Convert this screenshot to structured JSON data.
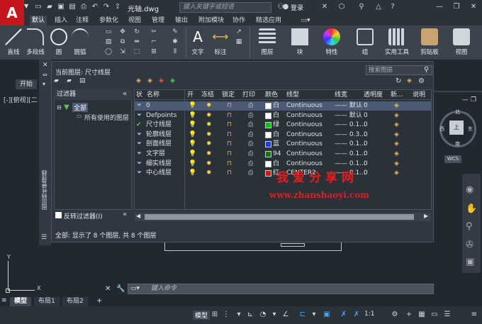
{
  "app": {
    "logo": "A",
    "filename": "光轴.dwg",
    "search_placeholder": "键入关键字或短语",
    "login": "登录"
  },
  "ribbon_tabs": [
    "默认",
    "插入",
    "注释",
    "参数化",
    "视图",
    "管理",
    "输出",
    "附加模块",
    "协作",
    "精选应用"
  ],
  "ribbon_buttons": [
    "直线",
    "多段线",
    "圆",
    "圆弧",
    "文字",
    "标注",
    "图层",
    "块",
    "特性",
    "组",
    "实用工具",
    "剪贴板",
    "视图"
  ],
  "start_tab": "开始",
  "view_label": "[-][俯视][二",
  "layer_panel": {
    "vertical_title": "图层特性管理器",
    "current_layer": "当前图层: 尺寸线层",
    "search_placeholder": "搜索图层",
    "filter_header": "过滤器",
    "filter_all": "全部",
    "filter_used": "所有使用的图层",
    "reverse_filter": "反转过滤器(I)",
    "status": "全部: 显示了 8 个图层, 共 8 个图层",
    "columns": [
      "状",
      "名称",
      "开",
      "冻结",
      "锁定",
      "打印",
      "颜色",
      "线型",
      "线宽",
      "透明度",
      "新...",
      "说明"
    ],
    "rows": [
      {
        "name": "0",
        "color": "#ffffff",
        "color_name": "白",
        "linetype": "Continuous",
        "lineweight": "—— 默认",
        "transparency": "0"
      },
      {
        "name": "Defpoints",
        "color": "#ffffff",
        "color_name": "白",
        "linetype": "Continuous",
        "lineweight": "—— 默认",
        "transparency": "0"
      },
      {
        "name": "尺寸线层",
        "color": "#00c800",
        "color_name": "绿",
        "linetype": "Continuous",
        "lineweight": "—— 0.1...",
        "transparency": "0"
      },
      {
        "name": "轮廓线层",
        "color": "#ffffff",
        "color_name": "白",
        "linetype": "Continuous",
        "lineweight": "—— 0.3...",
        "transparency": "0"
      },
      {
        "name": "剖面线层",
        "color": "#1a3cff",
        "color_name": "蓝",
        "linetype": "Continuous",
        "lineweight": "—— 0.1...",
        "transparency": "0"
      },
      {
        "name": "文字层",
        "color": "#0a7a0a",
        "color_name": "94",
        "linetype": "Continuous",
        "lineweight": "—— 0.1...",
        "transparency": "0"
      },
      {
        "name": "细实线层",
        "color": "#ffffff",
        "color_name": "白",
        "linetype": "Continuous",
        "lineweight": "—— 0.1...",
        "transparency": "0"
      },
      {
        "name": "中心线层",
        "color": "#e01010",
        "color_name": "红",
        "linetype": "CENTER2",
        "lineweight": "—— 0.1...",
        "transparency": "0"
      }
    ]
  },
  "viewcube": {
    "north": "北",
    "west": "西",
    "east": "东",
    "south": "南",
    "top": "上",
    "wcs": "WCS"
  },
  "watermark": {
    "cn": "我爱分享网",
    "url": "www.zhanshaoyi.com"
  },
  "command": {
    "placeholder": "键入命令"
  },
  "layout_tabs": [
    "模型",
    "布局1",
    "布局2"
  ],
  "statusbar": {
    "model": "模型",
    "scale": "1:1"
  },
  "colors": {
    "accent": "#49a7ff",
    "logo": "#c4161c",
    "watermark": "#e41d1d"
  }
}
